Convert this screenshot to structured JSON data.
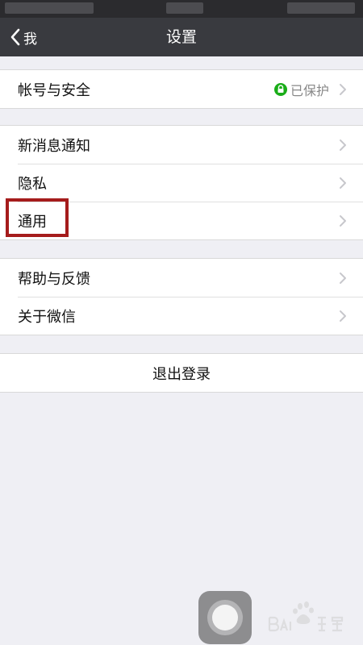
{
  "nav": {
    "back_label": "我",
    "title": "设置"
  },
  "groups": [
    {
      "items": [
        {
          "label": "帐号与安全",
          "status": "已保护"
        }
      ]
    },
    {
      "items": [
        {
          "label": "新消息通知"
        },
        {
          "label": "隐私"
        },
        {
          "label": "通用"
        }
      ]
    },
    {
      "items": [
        {
          "label": "帮助与反馈"
        },
        {
          "label": "关于微信"
        }
      ]
    }
  ],
  "logout": {
    "label": "退出登录"
  },
  "icons": {
    "back": "chevron-left-icon",
    "lock": "lock-icon",
    "row_arrow": "chevron-right-icon",
    "assistive": "assistive-touch-icon"
  },
  "colors": {
    "nav_background": "#393a3f",
    "page_background": "#efeff4",
    "protected_green": "#1aad19",
    "highlight_red": "#a51c1c"
  }
}
